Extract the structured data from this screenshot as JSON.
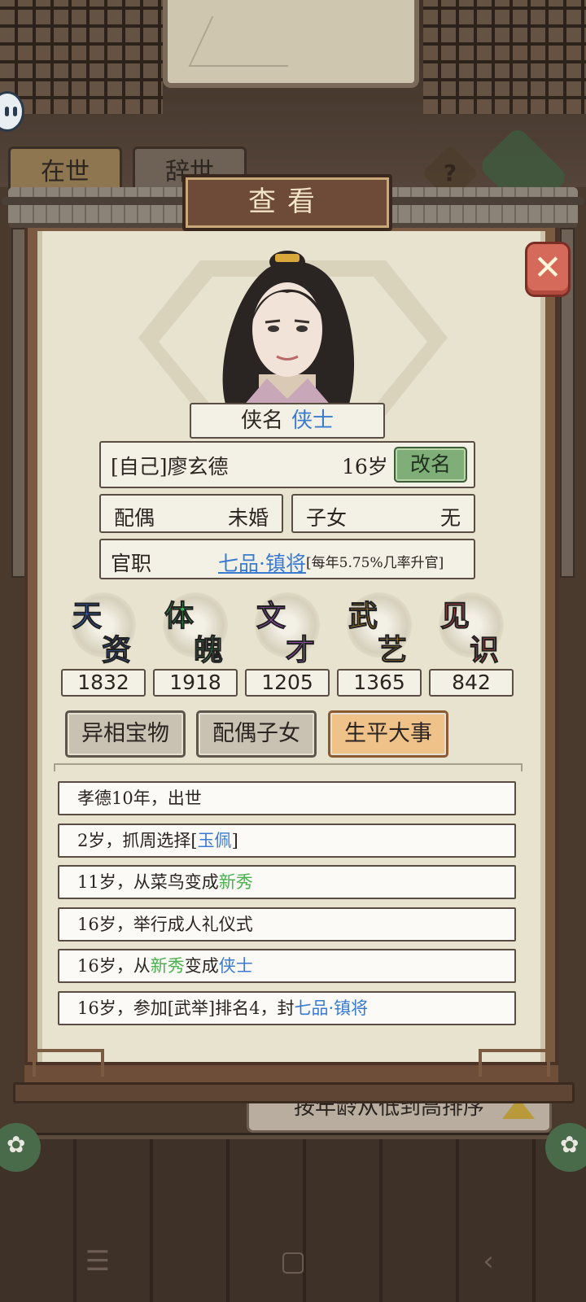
{
  "background": {
    "tabs": [
      "在世",
      "辞世"
    ],
    "help_icon": "?",
    "sort_label": "按年龄从低到高排序"
  },
  "dialog": {
    "title": "查看",
    "close_icon": "x-close-icon"
  },
  "profile": {
    "nickname_label": "侠名",
    "nickname_value": "侠士",
    "name": "[自己]廖玄德",
    "age": "16岁",
    "rename_label": "改名",
    "spouse_label": "配偶",
    "spouse_value": "未婚",
    "children_label": "子女",
    "children_value": "无",
    "office_label": "官职",
    "office_rank": "七品·镇将",
    "office_rate": "[每年5.75%几率升官]"
  },
  "attributes": [
    {
      "chars": [
        "天",
        "资"
      ],
      "value": "1832",
      "color": "#3a6fd8"
    },
    {
      "chars": [
        "体",
        "魄"
      ],
      "value": "1918",
      "color": "#3fb85a"
    },
    {
      "chars": [
        "文",
        "才"
      ],
      "value": "1205",
      "color": "#b05ad0"
    },
    {
      "chars": [
        "武",
        "艺"
      ],
      "value": "1365",
      "color": "#e0a030"
    },
    {
      "chars": [
        "见",
        "识"
      ],
      "value": "842",
      "color": "#e05050"
    }
  ],
  "tabs": [
    {
      "label": "异相宝物",
      "active": false
    },
    {
      "label": "配偶子女",
      "active": false
    },
    {
      "label": "生平大事",
      "active": true
    }
  ],
  "events": [
    {
      "parts": [
        {
          "text": "孝德10年，出世"
        }
      ]
    },
    {
      "parts": [
        {
          "text": "2岁，抓周选择["
        },
        {
          "text": "玉佩",
          "color": "blue"
        },
        {
          "text": "]"
        }
      ]
    },
    {
      "parts": [
        {
          "text": "11岁，从菜鸟变成"
        },
        {
          "text": "新秀",
          "color": "green"
        }
      ]
    },
    {
      "parts": [
        {
          "text": "16岁，举行成人礼仪式"
        }
      ]
    },
    {
      "parts": [
        {
          "text": "16岁，从"
        },
        {
          "text": "新秀",
          "color": "green"
        },
        {
          "text": "变成"
        },
        {
          "text": "侠士",
          "color": "blue"
        }
      ]
    },
    {
      "parts": [
        {
          "text": "16岁，参加[武举]排名4，封"
        },
        {
          "text": "七品·镇将",
          "color": "blue"
        }
      ]
    }
  ],
  "navbar": {
    "menu": "☰",
    "home": "▢",
    "back": "‹"
  }
}
